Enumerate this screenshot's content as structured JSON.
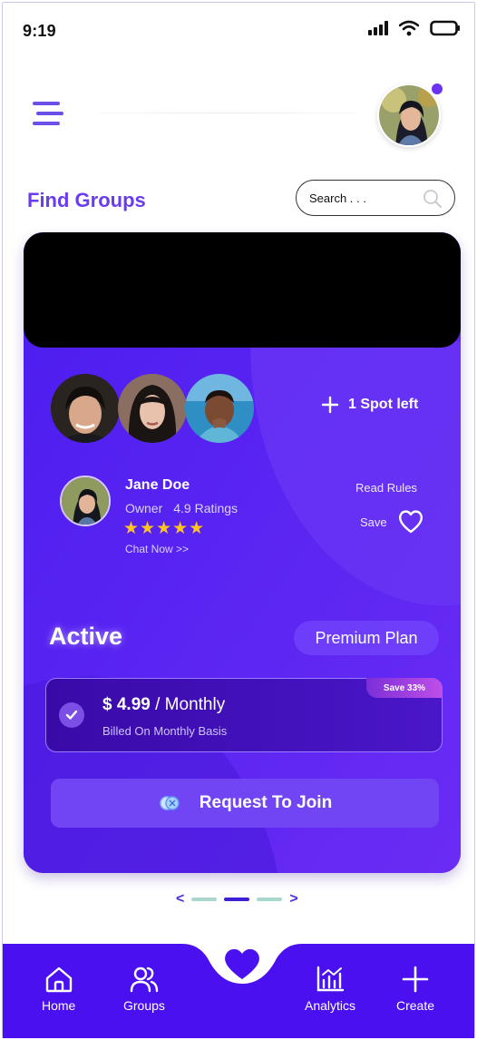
{
  "status_bar": {
    "time": "9:19"
  },
  "header": {
    "menu_icon": "hamburger-menu-icon",
    "avatar_icon": "user-avatar",
    "notification_color": "#6a34f0"
  },
  "title": "Find Groups",
  "search": {
    "placeholder": "Search . . .",
    "icon": "search-icon"
  },
  "card": {
    "spot_label": "1 Spot left",
    "owner": {
      "name": "Jane Doe",
      "role": "Owner",
      "ratings": "4.9 Ratings",
      "stars": "★★★★★",
      "rating_value": 5,
      "chat": "Chat Now >>"
    },
    "read_rules": "Read Rules",
    "save_label": "Save",
    "status": "Active",
    "plan_tag": "Premium Plan",
    "plan": {
      "price": "$ 4.99",
      "separator": " / ",
      "period": "Monthly",
      "billed": "Billed On Monthly Basis",
      "badge": "Save 33%"
    },
    "join_label": "Request To Join",
    "colors": {
      "card": "#5a22f0",
      "accent": "#6a3cf0",
      "star": "#ffc51a"
    }
  },
  "pager": {
    "prev": "<",
    "next": ">",
    "pages": 3,
    "active_index": 1
  },
  "bottom_nav": {
    "items": [
      {
        "label": "Home",
        "icon": "home-icon"
      },
      {
        "label": "Groups",
        "icon": "groups-icon"
      },
      {
        "label": "Analytics",
        "icon": "analytics-icon"
      },
      {
        "label": "Create",
        "icon": "plus-icon"
      }
    ],
    "center_icon": "heart-icon",
    "color": "#4a10f0"
  }
}
